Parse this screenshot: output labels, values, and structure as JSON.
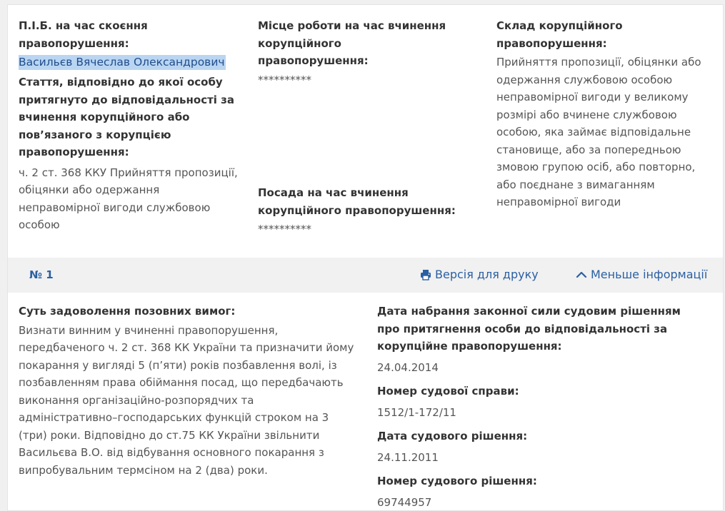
{
  "top": {
    "fio_label": "П.І.Б. на час скоєння правопорушення:",
    "fio_value": "Васильєв Вячеслав Олександрович",
    "article_label": "Стаття, відповідно до якої особу притягнуто до відповідальності за вчинення корупційного або пов’язаного з корупцією правопорушення:",
    "article_value": "ч. 2 ст. 368 ККУ Прийняття пропозиції, обіцянки або одержання неправомірної вигоди службовою особою",
    "workplace_label": "Місце роботи на час вчинення корупційного правопорушення:",
    "workplace_value": "**********",
    "position_label": "Посада на час вчинення корупційного правопорушення:",
    "position_value": "**********",
    "composition_label": "Склад корупційного правопорушення:",
    "composition_value": "Прийняття пропозиції, обіцянки або одержання службовою особою неправомірної вигоди у великому розмірі або вчинене службовою особою, яка займає відповідальне становище, або за попередньою змовою групою осіб, або повторно, або поєднане з вимаганням неправомірної вигоди"
  },
  "bar": {
    "number": "№ 1",
    "print_label": "Версія для друку",
    "less_label": "Меньше інформації",
    "print_icon": "printer-icon",
    "less_icon": "chevron-up-icon"
  },
  "bottom": {
    "claims_label": "Суть задоволення позовних вимог:",
    "claims_value": "Визнати винним у вчиненні правопорушення, передбаченого ч. 2 ст. 368 КК України та призначити йому покарання у вигляді 5 (п’яти) років позбавлення волі, із позбавленням права обіймання посад, що передбачають виконання організаційно-розпорядчих та адміністративно–господарських функцій строком на 3 (три) роки. Відповідно до ст.75 КК України звільнити Васильєва В.О. від відбування основного покарання з випробувальним термсіном на 2 (два) роки.",
    "effective_date_label": "Дата набрання законної сили судовим рішенням про притягнення особи до відповідальності за корупційне правопорушення:",
    "effective_date_value": "24.04.2014",
    "case_number_label": "Номер судової справи:",
    "case_number_value": "1512/1-172/11",
    "decision_date_label": "Дата судового рішення:",
    "decision_date_value": "24.11.2011",
    "decision_number_label": "Номер судового рішення:",
    "decision_number_value": "69744957"
  },
  "colors": {
    "accent": "#2a5fa3",
    "highlight": "#bad5f2",
    "bar_bg": "#f1f1f1"
  }
}
